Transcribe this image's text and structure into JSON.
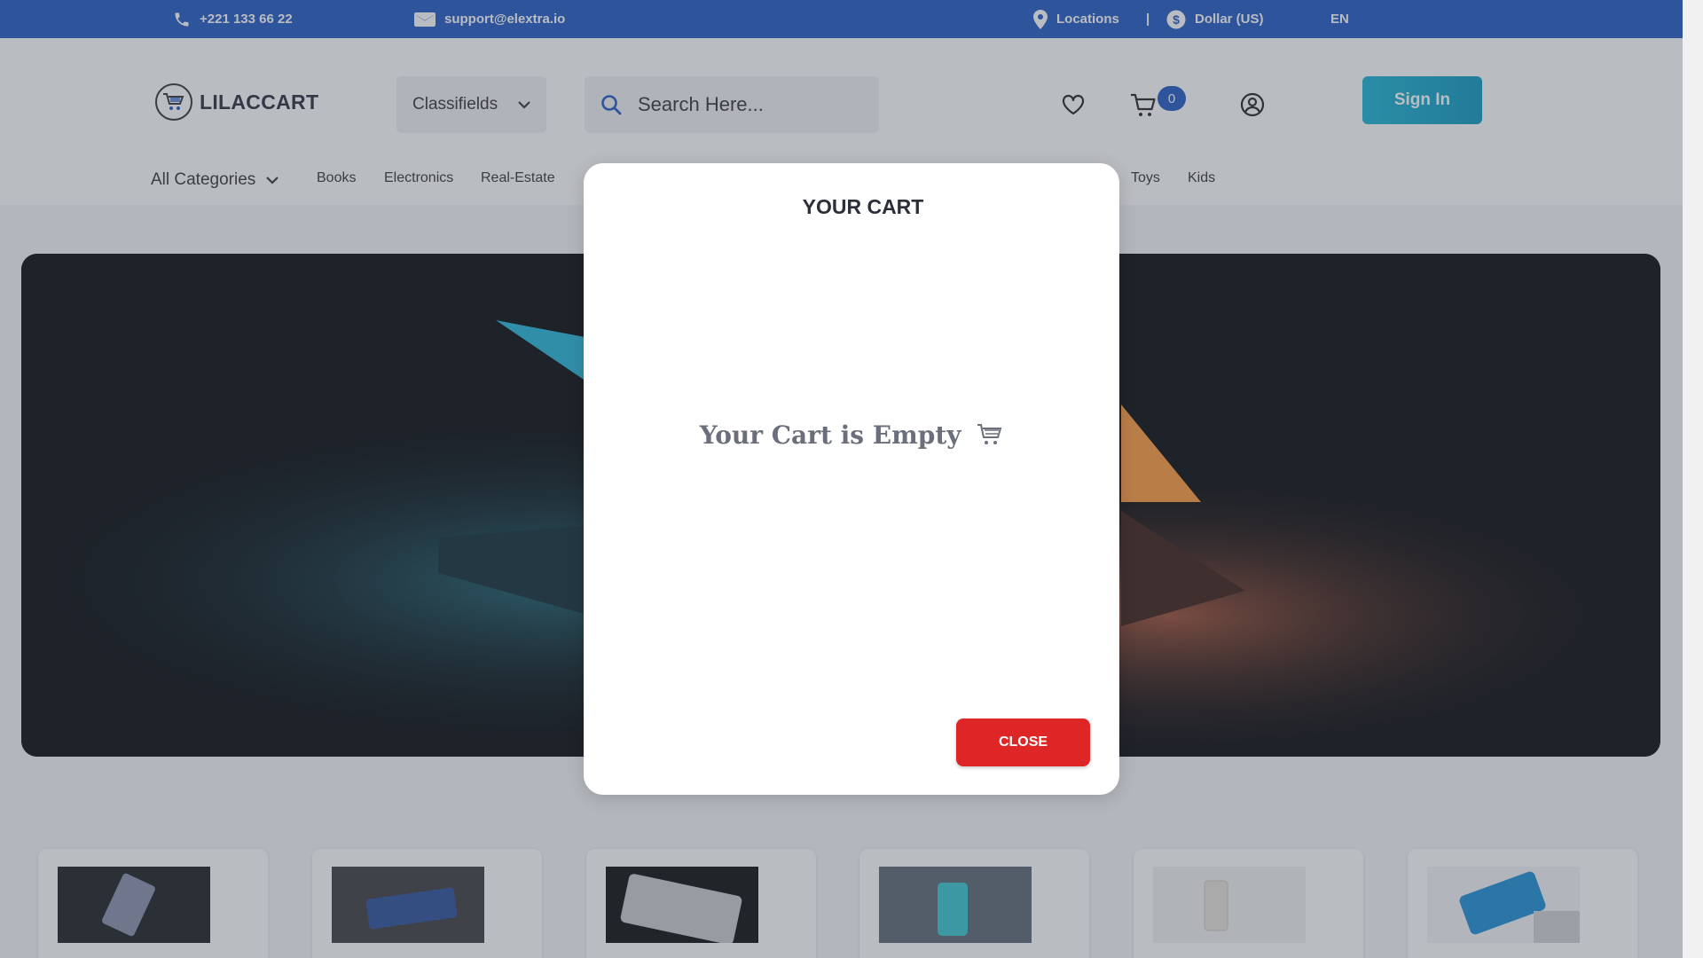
{
  "topbar": {
    "phone": "+221 133 66 22",
    "email": "support@elextra.io",
    "locations": "Locations",
    "separator": "|",
    "currency": "Dollar (US)",
    "language": "EN"
  },
  "header": {
    "logo_text": "LILACCART",
    "category_select": "Classifields",
    "search_placeholder": "Search Here...",
    "cart_count": "0",
    "signin_label": "Sign In"
  },
  "nav": {
    "all_categories": "All Categories",
    "categories": [
      "Books",
      "Electronics",
      "Real-Estate",
      "Toys",
      "Kids"
    ]
  },
  "modal": {
    "title": "YOUR CART",
    "empty_message": "Your Cart is Empty",
    "close_label": "CLOSE"
  },
  "icons": {
    "phone": "phone-icon",
    "email": "envelope-icon",
    "location": "map-pin-icon",
    "currency": "dollar-circle-icon",
    "search": "search-icon",
    "wishlist": "heart-icon",
    "cart": "cart-icon",
    "account": "user-circle-icon",
    "logo": "cart-logo-icon",
    "dropdown": "chevron-down-icon"
  },
  "colors": {
    "topbar": "#1f57c3",
    "signin": "#0c97bf",
    "close": "#df2626",
    "badge": "#1f57c3"
  }
}
